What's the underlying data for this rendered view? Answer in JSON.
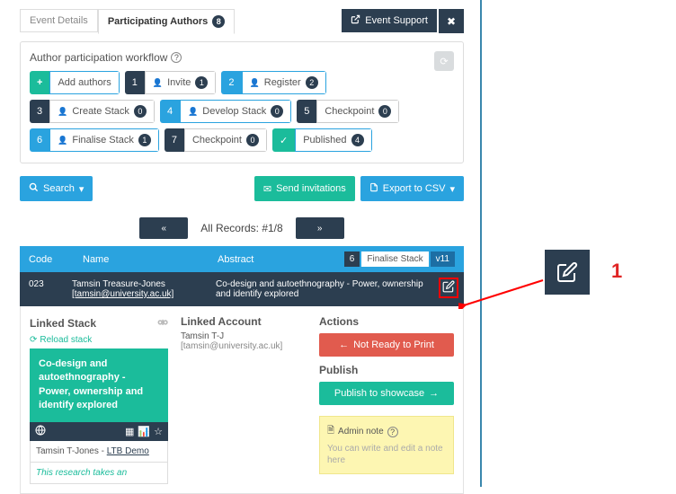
{
  "tabs": {
    "event_details": "Event Details",
    "participating_authors": "Participating Authors",
    "participating_count": "8"
  },
  "event_support": "Event Support",
  "workflow": {
    "title": "Author participation workflow",
    "add": "Add authors",
    "steps": [
      {
        "n": "1",
        "label": "Invite",
        "count": "1"
      },
      {
        "n": "2",
        "label": "Register",
        "count": "2"
      },
      {
        "n": "3",
        "label": "Create Stack",
        "count": "0"
      },
      {
        "n": "4",
        "label": "Develop Stack",
        "count": "0"
      },
      {
        "n": "5",
        "label": "Checkpoint",
        "count": "0"
      },
      {
        "n": "6",
        "label": "Finalise Stack",
        "count": "1"
      },
      {
        "n": "7",
        "label": "Checkpoint",
        "count": "0"
      }
    ],
    "published": "Published",
    "published_count": "4"
  },
  "toolbar": {
    "search": "Search",
    "send_invites": "Send invitations",
    "export_csv": "Export to CSV"
  },
  "pager": {
    "label": "All Records:  #1/8"
  },
  "grid": {
    "head_code": "Code",
    "head_name": "Name",
    "head_abstract": "Abstract",
    "stage_num": "6",
    "stage_label": "Finalise Stack",
    "stage_ver": "v11",
    "row": {
      "code": "023",
      "name": "Tamsin Treasure-Jones",
      "email": "[tamsin@university.ac.uk]",
      "abstract": "Co-design and autoethnography - Power, ownership and identify explored"
    }
  },
  "lower": {
    "linked_stack": "Linked Stack",
    "reload": "Reload stack",
    "stack_title": "Co-design and autoethnography - Power, ownership and identify explored",
    "stack_author": "Tamsin T-Jones",
    "stack_author_sep": " - ",
    "stack_org": "LTB Demo",
    "stack_desc": "This research takes an",
    "linked_account": "Linked Account",
    "la_name": "Tamsin T-J",
    "la_email": "[tamsin@university.ac.uk]",
    "actions": "Actions",
    "not_ready": "Not Ready to Print",
    "publish": "Publish",
    "publish_btn": "Publish to showcase",
    "admin_note": "Admin note",
    "admin_ph": "You can write and edit a note here"
  },
  "annotation": {
    "num": "1"
  }
}
